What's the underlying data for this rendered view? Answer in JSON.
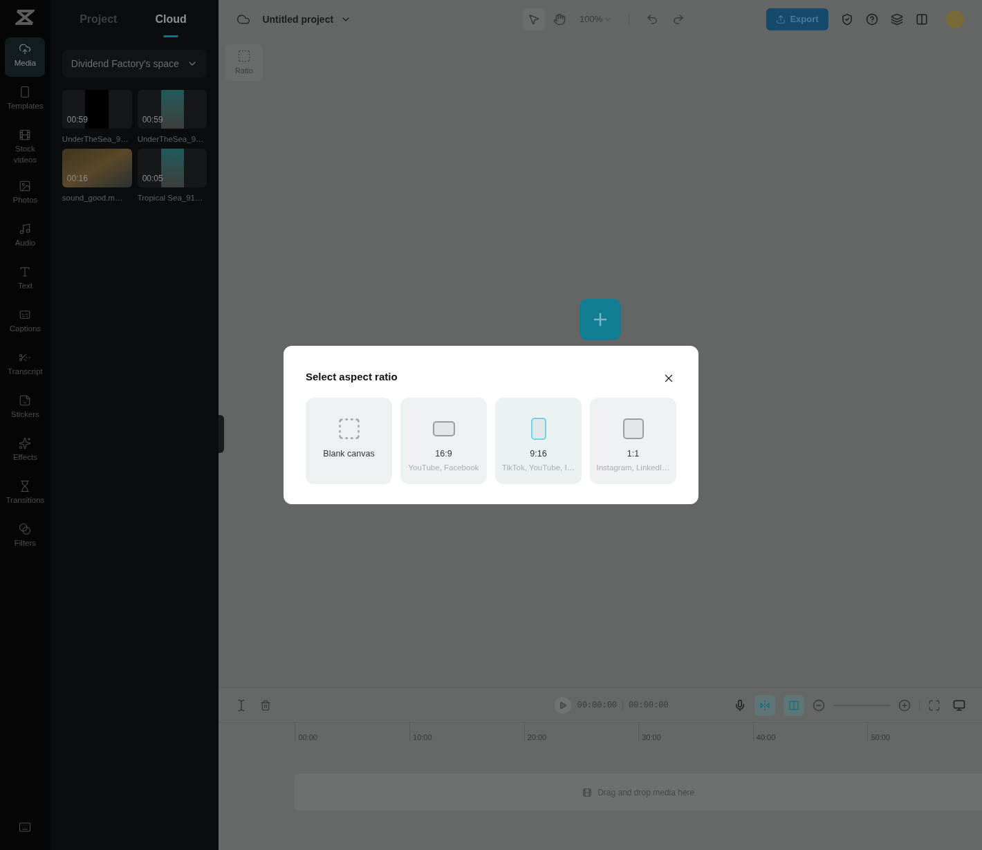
{
  "rail": {
    "items": [
      {
        "label": "Media",
        "selected": true
      },
      {
        "label": "Templates",
        "selected": false
      },
      {
        "label": "Stock videos",
        "selected": false
      },
      {
        "label": "Photos",
        "selected": false
      },
      {
        "label": "Audio",
        "selected": false
      },
      {
        "label": "Text",
        "selected": false
      },
      {
        "label": "Captions",
        "selected": false
      },
      {
        "label": "Transcript",
        "selected": false
      },
      {
        "label": "Stickers",
        "selected": false
      },
      {
        "label": "Effects",
        "selected": false
      },
      {
        "label": "Transitions",
        "selected": false
      },
      {
        "label": "Filters",
        "selected": false
      }
    ]
  },
  "panel": {
    "tabs": [
      {
        "label": "Project",
        "selected": false
      },
      {
        "label": "Cloud",
        "selected": true
      }
    ],
    "space": "Dividend Factory's space",
    "media": [
      {
        "duration": "00:59",
        "name": "UnderTheSea_9…",
        "kind": "dark"
      },
      {
        "duration": "00:59",
        "name": "UnderTheSea_9…",
        "kind": "sea"
      },
      {
        "duration": "00:16",
        "name": "sound_good.m…",
        "kind": "sand"
      },
      {
        "duration": "00:05",
        "name": "Tropical Sea_91…",
        "kind": "sea"
      }
    ]
  },
  "topbar": {
    "project": "Untitled project",
    "zoom": "100%",
    "export": "Export"
  },
  "ratio_button": "Ratio",
  "timeline": {
    "zoom_slider": {
      "level": 0
    },
    "current": "00:00:00",
    "total": "00:00:00",
    "ruler": [
      "00:00",
      "10:00",
      "20:00",
      "30:00",
      "40:00",
      "50:00"
    ],
    "drop_hint": "Drag and drop media here"
  },
  "dialog": {
    "title": "Select aspect ratio",
    "options": [
      {
        "kind": "blank",
        "label": "Blank canvas",
        "selected": false
      },
      {
        "kind": "landscape",
        "label": "16:9",
        "sub": "YouTube, Facebook",
        "selected": false
      },
      {
        "kind": "portrait",
        "label": "9:16",
        "sub": "TikTok, YouTube, I…",
        "selected": true
      },
      {
        "kind": "square",
        "label": "1:1",
        "sub": "Instagram, LinkedI…",
        "selected": false
      }
    ]
  }
}
